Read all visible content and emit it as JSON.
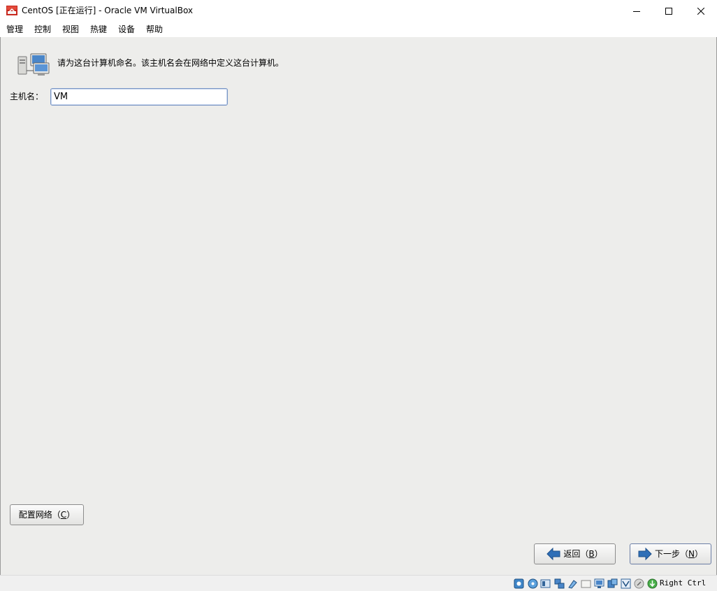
{
  "window": {
    "title": "CentOS [正在运行] - Oracle VM VirtualBox"
  },
  "menu": {
    "items": [
      "管理",
      "控制",
      "视图",
      "热键",
      "设备",
      "帮助"
    ]
  },
  "installer": {
    "prompt": "请为这台计算机命名。该主机名会在网络中定义这台计算机。",
    "hostname_label": "主机名：",
    "hostname_value": "VM",
    "configure_network": {
      "label": "配置网络（",
      "mnemonic": "C",
      "suffix": "）"
    },
    "back": {
      "label": "返回（",
      "mnemonic": "B",
      "suffix": "）"
    },
    "next": {
      "label": "下一步（",
      "mnemonic": "N",
      "suffix": "）"
    }
  },
  "statusbar": {
    "host_key": "Right Ctrl",
    "icons": [
      "hard-disk-icon",
      "optical-drive-icon",
      "audio-icon",
      "network-icon",
      "usb-icon",
      "shared-folders-icon",
      "display-icon",
      "video-capture-icon",
      "virtualization-icon",
      "mouse-integration-icon",
      "keyboard-capture-icon"
    ]
  },
  "colors": {
    "guest_background": "#ededeb",
    "input_border": "#7a96c4",
    "arrow_blue": "#2f6fb7"
  }
}
